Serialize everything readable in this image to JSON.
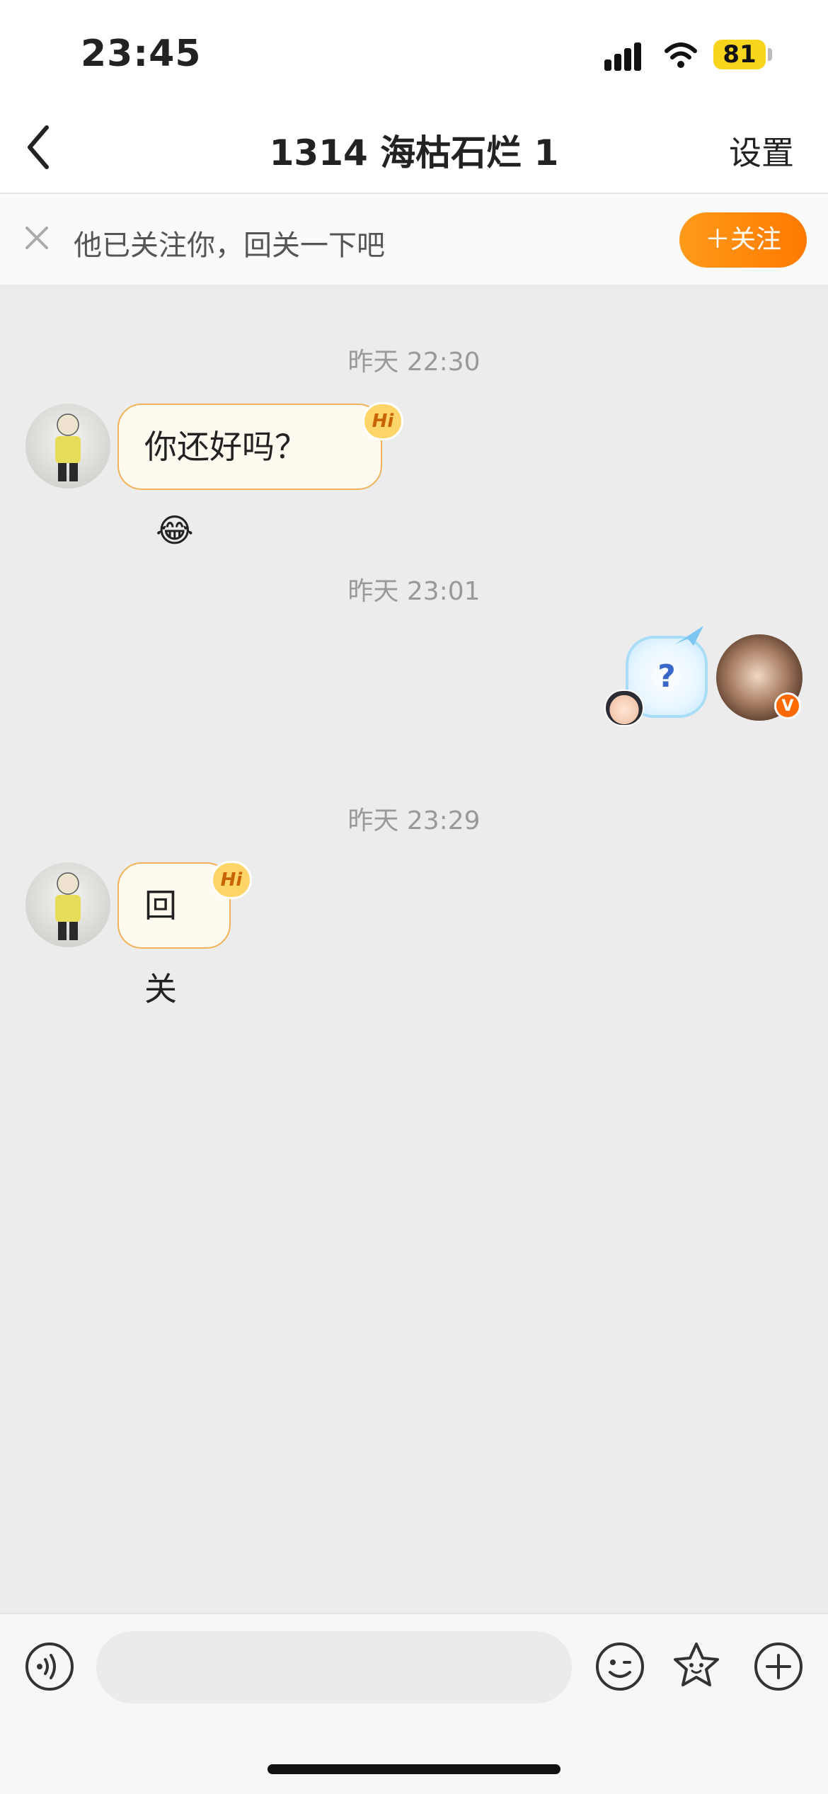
{
  "status_bar": {
    "time": "23:45",
    "battery": "81"
  },
  "nav": {
    "title": "1314 海枯石烂 1",
    "settings": "设置"
  },
  "banner": {
    "text": "他已关注你，回关一下吧",
    "follow": "＋关注"
  },
  "messages": [
    {
      "time": "昨天 22:30",
      "side": "left",
      "text": "你还好吗？",
      "emoji": "😂",
      "badge": "Hi"
    },
    {
      "time": "昨天 23:01",
      "side": "right",
      "sticker": "?",
      "avatar_badge": "V"
    },
    {
      "time": "昨天 23:29",
      "side": "left",
      "text": "回关",
      "badge": "Hi"
    }
  ],
  "input": {
    "placeholder": ""
  },
  "icons": [
    "back-icon",
    "close-icon",
    "voice-icon",
    "emoji-icon",
    "star-face-icon",
    "plus-icon"
  ]
}
